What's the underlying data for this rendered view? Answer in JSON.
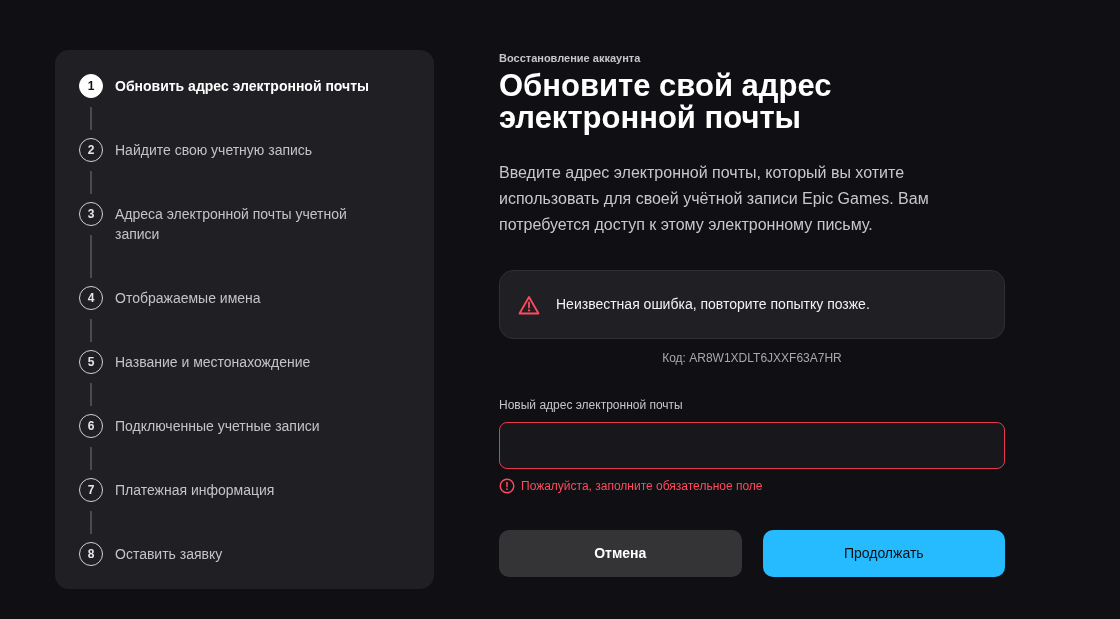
{
  "steps": [
    {
      "number": "1",
      "label": "Обновить адрес электронной почты",
      "selected": true
    },
    {
      "number": "2",
      "label": "Найдите свою учетную запись",
      "selected": false
    },
    {
      "number": "3",
      "label": "Адреса электронной почты учетной записи",
      "selected": false
    },
    {
      "number": "4",
      "label": "Отображаемые имена",
      "selected": false
    },
    {
      "number": "5",
      "label": "Название и местонахождение",
      "selected": false
    },
    {
      "number": "6",
      "label": "Подключенные учетные записи",
      "selected": false
    },
    {
      "number": "7",
      "label": "Платежная информация",
      "selected": false
    },
    {
      "number": "8",
      "label": "Оставить заявку",
      "selected": false
    }
  ],
  "form": {
    "eyebrow": "Восстановление аккаунта",
    "title": "Обновите свой адрес электронной почты",
    "description": "Введите адрес электронной почты, который вы хотите использовать для своей учётной записи Epic Games. Вам потребуется доступ к этому электронному письму.",
    "alert": {
      "message": "Неизвестная ошибка, повторите попытку позже."
    },
    "error_code": "Код: AR8W1XDLT6JXXF63A7HR",
    "email_field": {
      "label": "Новый адрес электронной почты",
      "invalid": true,
      "error": "Пожалуйста, заполните обязательное поле"
    },
    "buttons": [
      {
        "label": "Отмена",
        "kind": "secondary"
      },
      {
        "label": "Продолжать",
        "kind": "primary"
      }
    ]
  }
}
